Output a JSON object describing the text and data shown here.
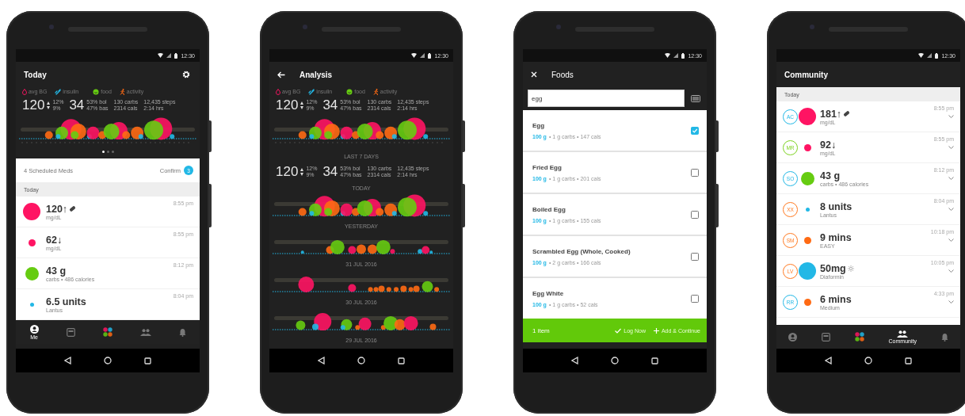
{
  "today": {
    "status_time": "12:30",
    "title": "Today",
    "stats": {
      "legend": [
        {
          "kind": "bg",
          "label": "avg BG"
        },
        {
          "kind": "insulin",
          "label": "insulin"
        },
        {
          "kind": "food",
          "label": "food"
        },
        {
          "kind": "activity",
          "label": "activity"
        }
      ],
      "bg": "120",
      "bg_high": "12%",
      "bg_low": "9%",
      "insulin": "34",
      "bolus": "53% bol",
      "basal": "47% bas",
      "carbs": "130 carbs",
      "calories": "2314 cals",
      "steps": "12,435 steps",
      "duration": "2:14 hrs"
    },
    "page_dots": [
      {
        "selected": true
      },
      {
        "selected": false
      },
      {
        "selected": false
      }
    ],
    "scheduled": {
      "label": "4 Scheduled Meds",
      "action": "Confirm",
      "count": "3"
    },
    "section": "Today",
    "entries": [
      {
        "kind": "bg_bolus",
        "value": "120↑",
        "detail": "mg/dL",
        "time": "8:55 pm",
        "dot": {
          "kind": "large",
          "color": "#ff1463"
        }
      },
      {
        "kind": "bg",
        "value": "62↓",
        "detail": "mg/dL",
        "time": "8:55 pm",
        "dot": {
          "kind": "small",
          "color": "#ff1463"
        }
      },
      {
        "kind": "food",
        "value": "43 g",
        "detail": "carbs • 486 calories",
        "time": "8:12 pm",
        "dot": {
          "kind": "medium",
          "color": "#66cc11"
        }
      },
      {
        "kind": "insulin",
        "value": "6.5 units",
        "detail": "Lantus",
        "time": "8:04 pm",
        "dot": {
          "kind": "tiny",
          "color": "#22b8e6"
        }
      }
    ],
    "bottom_nav": [
      {
        "kind": "profile",
        "label": "Me",
        "selected": true
      },
      {
        "kind": "diary",
        "selected": false
      },
      {
        "kind": "apps",
        "selected": false
      },
      {
        "kind": "community",
        "selected": false
      },
      {
        "kind": "alerts",
        "selected": false
      }
    ]
  },
  "analysis": {
    "status_time": "12:30",
    "title": "Analysis",
    "blocks": [
      {
        "kind": "stats",
        "stats": {
          "legend": [
            {
              "kind": "bg",
              "label": "avg BG"
            },
            {
              "kind": "insulin",
              "label": "insulin"
            },
            {
              "kind": "food",
              "label": "food"
            },
            {
              "kind": "activity",
              "label": "activity"
            }
          ],
          "bg": "120",
          "bg_high": "12%",
          "bg_low": "9%",
          "insulin": "34",
          "bolus": "53% bol",
          "basal": "47% bas",
          "carbs": "130 carbs",
          "calories": "2314 cals",
          "steps": "12,435 steps",
          "duration": "2:14 hrs"
        }
      },
      {
        "kind": "chart_with_axis"
      },
      {
        "kind": "label",
        "text": "LAST 7 DAYS"
      },
      {
        "kind": "stats",
        "stats": {
          "bg": "120",
          "bg_high": "12%",
          "bg_low": "9%",
          "insulin": "34",
          "bolus": "53% bol",
          "basal": "47% bas",
          "carbs": "130 carbs",
          "calories": "2314 cals",
          "steps": "12,435 steps",
          "duration": "2:14 hrs"
        }
      },
      {
        "kind": "label",
        "text": "TODAY"
      },
      {
        "kind": "chart"
      },
      {
        "kind": "label",
        "text": "YESTERDAY"
      },
      {
        "kind": "chart"
      },
      {
        "kind": "label",
        "text": "31 JUL 2016"
      },
      {
        "kind": "chart"
      },
      {
        "kind": "label",
        "text": "30 JUL 2016"
      },
      {
        "kind": "chart"
      },
      {
        "kind": "label",
        "text": "29 JUL 2016"
      }
    ]
  },
  "foods": {
    "status_time": "12:30",
    "title": "Foods",
    "search": {
      "value": "egg"
    },
    "items": [
      {
        "name": "Egg",
        "amount": "100 g",
        "detail": "• 1 g carbs • 147 cals",
        "checked": true
      },
      {
        "name": "Fried Egg",
        "amount": "100 g",
        "detail": "• 1 g carbs • 201 cals",
        "checked": false
      },
      {
        "name": "Boiled Egg",
        "amount": "100 g",
        "detail": "• 1 g carbs • 155 cals",
        "checked": false
      },
      {
        "name": "Scrambled Egg (Whole, Cooked)",
        "amount": "100 g",
        "detail": "• 2 g carbs • 166 cals",
        "checked": false
      },
      {
        "name": "Egg White",
        "amount": "100 g",
        "detail": "• 1 g carbs • 52 cals",
        "checked": false
      }
    ],
    "footer": {
      "count": "1 item",
      "log": "Log Now",
      "add": "Add & Continue"
    }
  },
  "community": {
    "status_time": "12:30",
    "title": "Community",
    "section": "Today",
    "entries": [
      {
        "kind": "bg_bolus",
        "avatar": {
          "initials": "AC",
          "color": "#22b8e6"
        },
        "value": "181↑",
        "detail": "mg/dL",
        "time": "8:55 pm",
        "dot": {
          "kind": "large",
          "color": "#ff1463"
        }
      },
      {
        "kind": "bg",
        "avatar": {
          "initials": "MR",
          "color": "#7ed321"
        },
        "value": "92↓",
        "detail": "mg/dL",
        "time": "8:55 pm",
        "dot": {
          "kind": "small",
          "color": "#ff1463"
        }
      },
      {
        "kind": "food",
        "avatar": {
          "initials": "SO",
          "color": "#22b8e6"
        },
        "value": "43 g",
        "detail": "carbs • 486 calories",
        "time": "8:12 pm",
        "dot": {
          "kind": "medium",
          "color": "#66cc11"
        }
      },
      {
        "kind": "insulin",
        "avatar": {
          "initials": "XX",
          "color": "#ff7a21"
        },
        "value": "8 units",
        "detail": "Lantus",
        "time": "8:04 pm",
        "dot": {
          "kind": "tiny",
          "color": "#22b8e6"
        }
      },
      {
        "kind": "exercise",
        "avatar": {
          "initials": "SM",
          "color": "#ff7a21"
        },
        "value": "9 mins",
        "detail": "EASY",
        "time": "10:18 pm",
        "dot": {
          "kind": "small",
          "color": "#ff6a13"
        }
      },
      {
        "kind": "medication",
        "avatar": {
          "initials": "LV",
          "color": "#ff7a21"
        },
        "value": "50mg",
        "detail": "Diaformin",
        "time": "10:05 pm",
        "dot": {
          "kind": "large",
          "color": "#22b8e6"
        }
      },
      {
        "kind": "exercise",
        "avatar": {
          "initials": "RR",
          "color": "#22b8e6"
        },
        "value": "6 mins",
        "detail": "Medium",
        "time": "4:33 pm",
        "dot": {
          "kind": "small",
          "color": "#ff6a13"
        }
      }
    ],
    "bottom_nav": [
      {
        "kind": "profile",
        "selected": false
      },
      {
        "kind": "diary",
        "selected": false
      },
      {
        "kind": "apps",
        "selected": false
      },
      {
        "kind": "community",
        "label": "Community",
        "selected": true
      },
      {
        "kind": "alerts",
        "selected": false
      }
    ]
  }
}
